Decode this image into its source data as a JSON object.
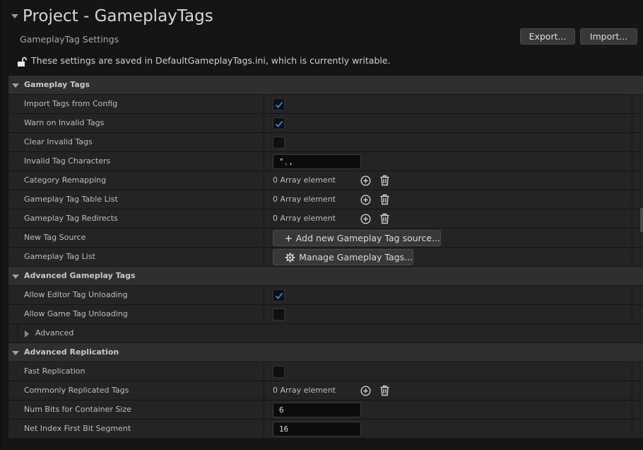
{
  "header": {
    "title": "Project - GameplayTags",
    "subtitle": "GameplayTag Settings",
    "export_label": "Export...",
    "import_label": "Import...",
    "save_note": "These settings are saved in DefaultGameplayTags.ini, which is currently writable."
  },
  "sections": {
    "gameplay_tags": {
      "title": "Gameplay Tags",
      "import_tags": {
        "label": "Import Tags from Config",
        "checked": true
      },
      "warn_invalid": {
        "label": "Warn on Invalid Tags",
        "checked": true
      },
      "clear_invalid": {
        "label": "Clear Invalid Tags",
        "checked": false
      },
      "invalid_chars": {
        "label": "Invalid Tag Characters",
        "value": "\",",
        "display": "\"ˌ,"
      },
      "category_remap": {
        "label": "Category Remapping",
        "value": "0 Array element"
      },
      "table_list": {
        "label": "Gameplay Tag Table List",
        "value": "0 Array element"
      },
      "redirects": {
        "label": "Gameplay Tag Redirects",
        "value": "0 Array element"
      },
      "new_source": {
        "label": "New Tag Source",
        "button": "Add new Gameplay Tag source..."
      },
      "tag_list": {
        "label": "Gameplay Tag List",
        "button": "Manage Gameplay Tags..."
      }
    },
    "advanced_gameplay_tags": {
      "title": "Advanced Gameplay Tags",
      "editor_unload": {
        "label": "Allow Editor Tag Unloading",
        "checked": true
      },
      "game_unload": {
        "label": "Allow Game Tag Unloading",
        "checked": false
      },
      "advanced": {
        "label": "Advanced"
      }
    },
    "advanced_replication": {
      "title": "Advanced Replication",
      "fast_rep": {
        "label": "Fast Replication",
        "checked": false
      },
      "common_tags": {
        "label": "Commonly Replicated Tags",
        "value": "0 Array element"
      },
      "num_bits": {
        "label": "Num Bits for Container Size",
        "value": "6"
      },
      "net_index": {
        "label": "Net Index First Bit Segment",
        "value": "16"
      }
    }
  },
  "icons": {
    "check_color": "#2a7fe0",
    "accent": "#2a7fe0"
  }
}
